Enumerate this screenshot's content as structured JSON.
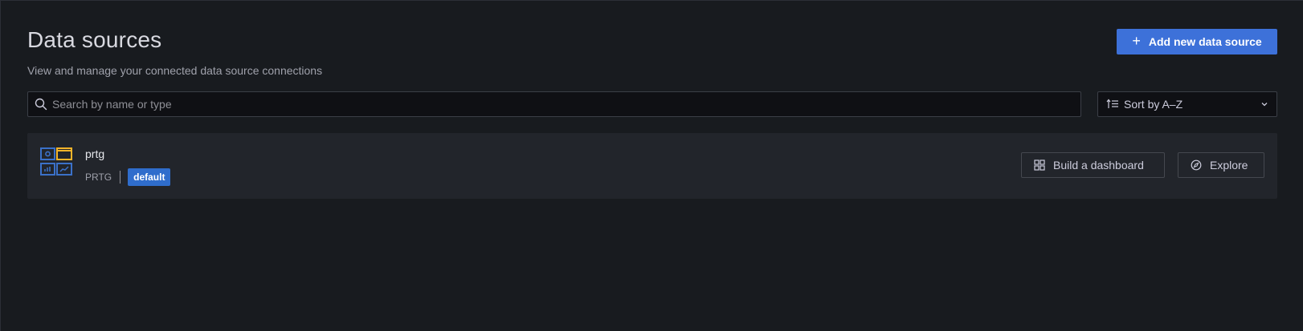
{
  "header": {
    "title": "Data sources",
    "subtitle": "View and manage your connected data source connections",
    "add_button_label": "Add new data source",
    "add_button_icon": "plus-icon"
  },
  "search": {
    "placeholder": "Search by name or type",
    "value": "",
    "icon": "search-icon"
  },
  "sort": {
    "label": "Sort by A–Z",
    "icon": "sort-icon"
  },
  "datasources": [
    {
      "name": "prtg",
      "type": "PRTG",
      "badge": "default",
      "actions": {
        "build_label": "Build a dashboard",
        "explore_label": "Explore"
      }
    }
  ],
  "colors": {
    "background": "#181b1f",
    "card": "#22252b",
    "primary": "#3d71d9",
    "badge": "#2f6dcc",
    "logo_blue": "#3b71c9",
    "logo_yellow": "#f5b52a"
  }
}
